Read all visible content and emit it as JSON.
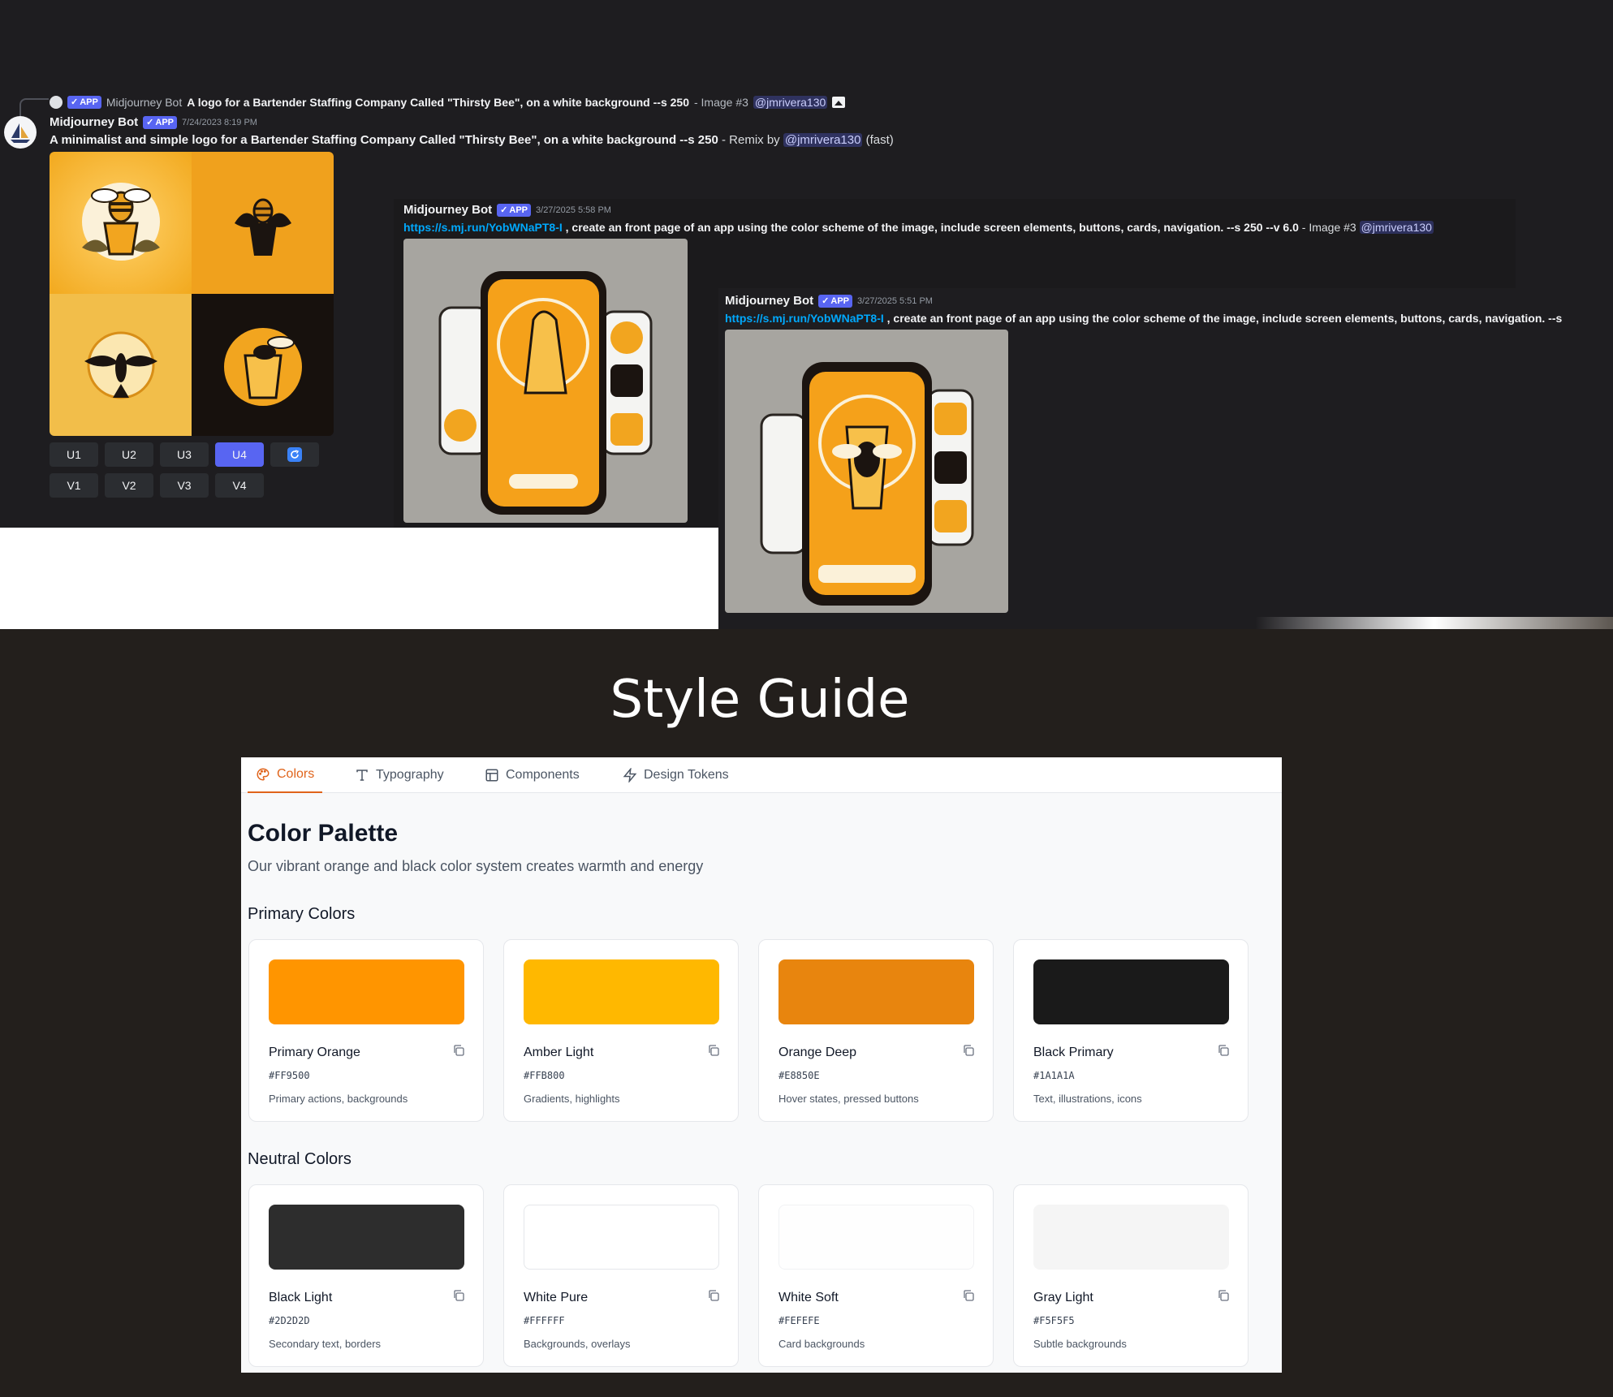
{
  "discord": {
    "reply": {
      "badge": "APP",
      "author": "Midjourney Bot",
      "prompt": "A logo for a Bartender Staffing Company Called \"Thirsty Bee\", on a white background --s 250",
      "suffix": "- Image #3",
      "mention": "@jmrivera130"
    },
    "msg1": {
      "author": "Midjourney Bot",
      "badge": "APP",
      "time": "7/24/2023 8:19 PM",
      "prompt": "A minimalist and simple logo for a Bartender Staffing Company Called \"Thirsty Bee\", on a white background --s 250",
      "remix": "- Remix by",
      "mention": "@jmrivera130",
      "speed": "(fast)",
      "upscale_buttons": [
        "U1",
        "U2",
        "U3",
        "U4"
      ],
      "variation_buttons": [
        "V1",
        "V2",
        "V3",
        "V4"
      ],
      "active_button": "U4",
      "reroll_icon": "refresh-icon"
    },
    "msg2": {
      "author": "Midjourney Bot",
      "badge": "APP",
      "time": "3/27/2025 5:58 PM",
      "link": "https://s.mj.run/YobWNaPT8-I",
      "prompt": ", create an front page of an app using the color scheme of the image, include screen elements, buttons, cards, navigation. --s 250 --v 6.0",
      "suffix": "- Image #3",
      "mention": "@jmrivera130"
    },
    "msg3": {
      "author": "Midjourney Bot",
      "badge": "APP",
      "time": "3/27/2025 5:51 PM",
      "link": "https://s.mj.run/YobWNaPT8-I",
      "prompt": ", create an front page of an app using the color scheme of the image, include screen elements, buttons, cards, navigation. --s"
    }
  },
  "style_guide": {
    "title": "Style Guide",
    "tabs": [
      {
        "label": "Colors",
        "icon": "palette-icon",
        "active": true
      },
      {
        "label": "Typography",
        "icon": "type-icon",
        "active": false
      },
      {
        "label": "Components",
        "icon": "layout-icon",
        "active": false
      },
      {
        "label": "Design Tokens",
        "icon": "zap-icon",
        "active": false
      }
    ],
    "heading": "Color Palette",
    "subheading": "Our vibrant orange and black color system creates warmth and energy",
    "primary_title": "Primary Colors",
    "primary": [
      {
        "name": "Primary Orange",
        "hex": "#FF9500",
        "use": "Primary actions, backgrounds",
        "color": "#FF9500"
      },
      {
        "name": "Amber Light",
        "hex": "#FFB800",
        "use": "Gradients, highlights",
        "color": "#FFB800"
      },
      {
        "name": "Orange Deep",
        "hex": "#E8850E",
        "use": "Hover states, pressed buttons",
        "color": "#E8850E"
      },
      {
        "name": "Black Primary",
        "hex": "#1A1A1A",
        "use": "Text, illustrations, icons",
        "color": "#1A1A1A"
      }
    ],
    "neutral_title": "Neutral Colors",
    "neutral": [
      {
        "name": "Black Light",
        "hex": "#2D2D2D",
        "use": "Secondary text, borders",
        "color": "#2D2D2D"
      },
      {
        "name": "White Pure",
        "hex": "#FFFFFF",
        "use": "Backgrounds, overlays",
        "color": "#FFFFFF"
      },
      {
        "name": "White Soft",
        "hex": "#FEFEFE",
        "use": "Card backgrounds",
        "color": "#FEFEFE"
      },
      {
        "name": "Gray Light",
        "hex": "#F5F5F5",
        "use": "Subtle backgrounds",
        "color": "#F5F5F5"
      }
    ],
    "accent_color": "#E0641B"
  }
}
